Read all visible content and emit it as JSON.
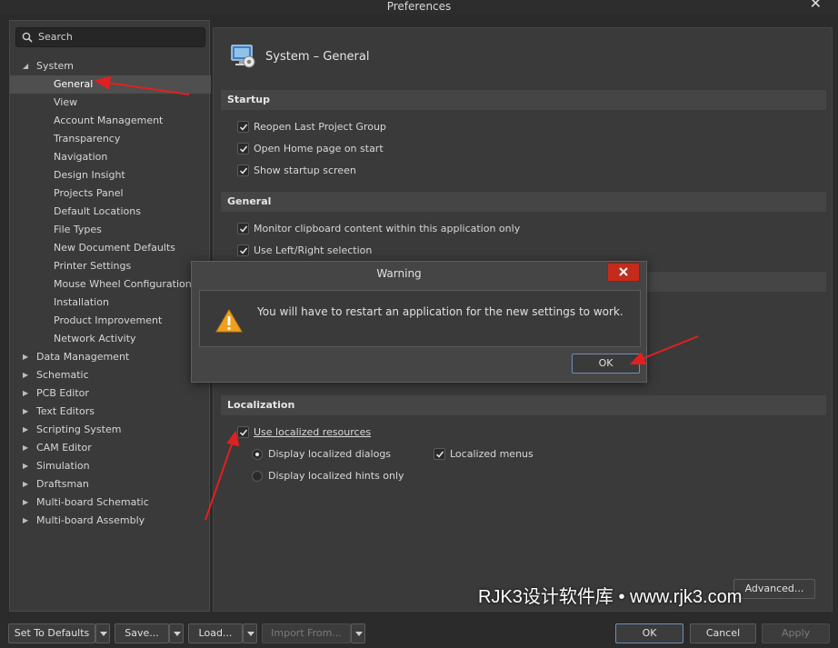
{
  "window": {
    "title": "Preferences"
  },
  "search": {
    "placeholder": "Search"
  },
  "tree": {
    "system": "System",
    "system_children": [
      "General",
      "View",
      "Account Management",
      "Transparency",
      "Navigation",
      "Design Insight",
      "Projects Panel",
      "Default Locations",
      "File Types",
      "New Document Defaults",
      "Printer Settings",
      "Mouse Wheel Configuration",
      "Installation",
      "Product Improvement",
      "Network Activity"
    ],
    "groups": [
      "Data Management",
      "Schematic",
      "PCB Editor",
      "Text Editors",
      "Scripting System",
      "CAM Editor",
      "Simulation",
      "Draftsman",
      "Multi-board Schematic",
      "Multi-board Assembly"
    ]
  },
  "page": {
    "title": "System – General",
    "startup_header": "Startup",
    "startup_items": [
      "Reopen Last Project Group",
      "Open Home page on start",
      "Show startup screen"
    ],
    "general_header": "General",
    "general_items": [
      "Monitor clipboard content within this application only",
      "Use Left/Right selection"
    ],
    "localization_header": "Localization",
    "use_localized": "Use localized resources",
    "display_dialogs": "Display localized dialogs",
    "localized_menus": "Localized menus",
    "display_hints": "Display localized hints only",
    "advanced": "Advanced..."
  },
  "dialog": {
    "title": "Warning",
    "message": "You will have to restart an application for the new settings to work.",
    "ok": "OK"
  },
  "footer": {
    "set_defaults": "Set To Defaults",
    "save": "Save...",
    "load": "Load...",
    "import": "Import From...",
    "ok": "OK",
    "cancel": "Cancel",
    "apply": "Apply"
  },
  "watermark": "RJK3设计软件库 • www.rjk3.com",
  "colors": {
    "dialog_close": "#c42b1c",
    "arrow": "#e02020",
    "warning": "#f0a020"
  }
}
